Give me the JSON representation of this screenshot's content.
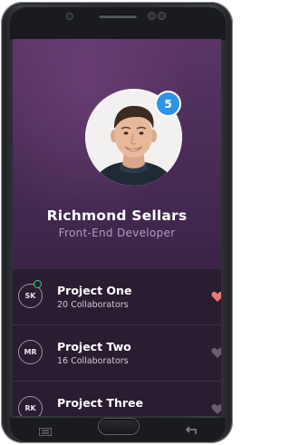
{
  "profile": {
    "name": "Richmond Sellars",
    "role": "Front-End Developer",
    "notification_count": "5"
  },
  "projects": [
    {
      "initials": "SK",
      "title": "Project One",
      "subtitle": "20 Collaborators",
      "online": true,
      "favorite": true
    },
    {
      "initials": "MR",
      "title": "Project Two",
      "subtitle": "16 Collaborators",
      "online": false,
      "favorite": false
    },
    {
      "initials": "RK",
      "title": "Project Three",
      "subtitle": "",
      "online": false,
      "favorite": false
    }
  ],
  "colors": {
    "header_background": "#4b2d57",
    "list_background": "#2a1c31",
    "badge": "#2f93e6",
    "favorite_heart": "#e77a73",
    "heart_inactive": "#6a5d70",
    "online_indicator": "#33d18a"
  },
  "icons": {
    "badge": "notification-badge",
    "heart": "heart-icon",
    "back": "back-arrow-icon",
    "menu": "menu-icon"
  }
}
